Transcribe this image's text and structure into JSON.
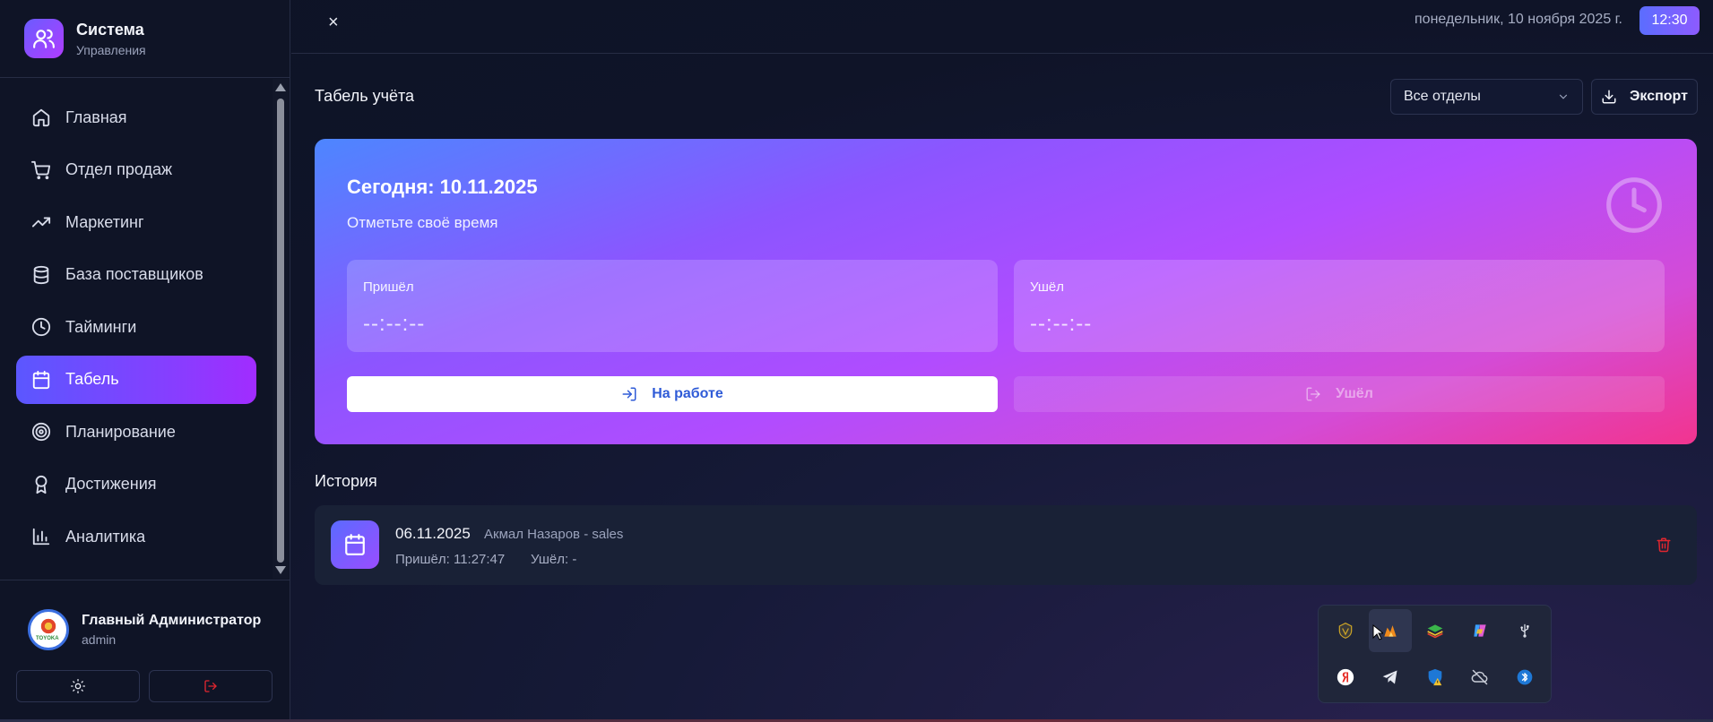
{
  "app": {
    "title": "Система",
    "subtitle": "Управления"
  },
  "sidebar": {
    "items": [
      {
        "label": "Главная",
        "icon": "home-icon",
        "active": false
      },
      {
        "label": "Отдел продаж",
        "icon": "cart-icon",
        "active": false
      },
      {
        "label": "Маркетинг",
        "icon": "trending-up-icon",
        "active": false
      },
      {
        "label": "База поставщиков",
        "icon": "database-icon",
        "active": false
      },
      {
        "label": "Тайминги",
        "icon": "clock-icon",
        "active": false
      },
      {
        "label": "Табель",
        "icon": "calendar-icon",
        "active": true
      },
      {
        "label": "Планирование",
        "icon": "target-icon",
        "active": false
      },
      {
        "label": "Достижения",
        "icon": "award-icon",
        "active": false
      },
      {
        "label": "Аналитика",
        "icon": "bar-chart-icon",
        "active": false
      }
    ]
  },
  "user": {
    "name": "Главный Администратор",
    "role": "admin",
    "avatar_text": "TOYOKA"
  },
  "topbar": {
    "date": "понедельник, 10 ноября 2025 г.",
    "time": "12:30",
    "close": "×"
  },
  "main": {
    "title": "Табель учёта",
    "department_filter": "Все отделы",
    "export_label": "Экспорт"
  },
  "today": {
    "title": "Сегодня: 10.11.2025",
    "subtitle": "Отметьте своё время",
    "arrived_label": "Пришёл",
    "arrived_value": "--:--:--",
    "left_label": "Ушёл",
    "left_value": "--:--:--",
    "checkin_button": "На работе",
    "checkout_button": "Ушёл"
  },
  "history": {
    "title": "История",
    "rows": [
      {
        "date": "06.11.2025",
        "user": "Акмал Назаров - sales",
        "arrived": "Пришёл: 11:27:47",
        "left": "Ушёл: -"
      }
    ]
  },
  "colors": {
    "accent": "#8a3cff",
    "accent_blue": "#5b57ff",
    "danger": "#e0262f",
    "background": "#0f1428"
  }
}
